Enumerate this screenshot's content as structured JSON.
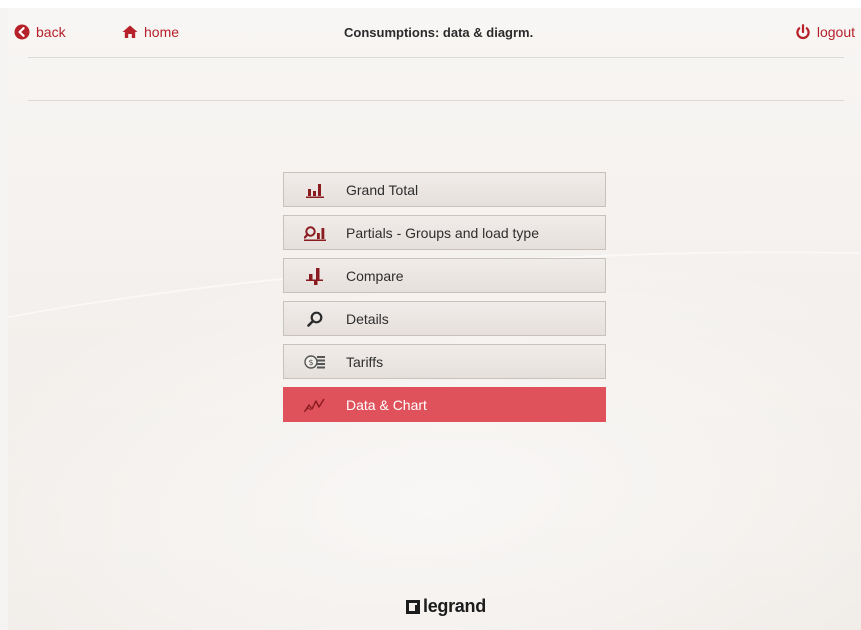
{
  "header": {
    "back_label": "back",
    "home_label": "home",
    "title": "Consumptions: data & diagrm.",
    "logout_label": "logout"
  },
  "menu": {
    "items": [
      {
        "label": "Grand Total",
        "icon": "grand-total-bar-chart-icon",
        "active": false
      },
      {
        "label": "Partials - Groups and load type",
        "icon": "partials-search-chart-icon",
        "active": false
      },
      {
        "label": "Compare",
        "icon": "compare-bars-icon",
        "active": false
      },
      {
        "label": "Details",
        "icon": "magnifier-icon",
        "active": false
      },
      {
        "label": "Tariffs",
        "icon": "coins-icon",
        "active": false
      },
      {
        "label": "Data & Chart",
        "icon": "line-chart-icon",
        "active": true
      }
    ]
  },
  "footer": {
    "logo_text": "legrand"
  },
  "colors": {
    "accent": "#b7212a",
    "active_item": "#e0525b",
    "menu_item_bg": "#ebe6e2",
    "icon_dark": "#8a1b1f",
    "background": "#f4f1ee"
  }
}
